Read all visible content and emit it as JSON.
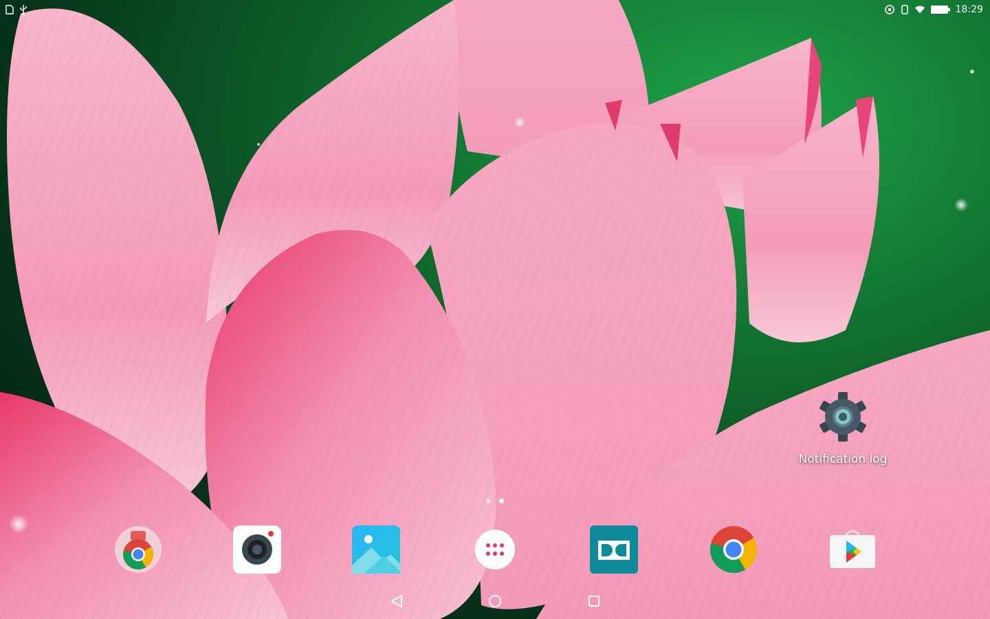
{
  "status_bar": {
    "time": "18:29",
    "left_icons": [
      "sd-card-icon",
      "usb-icon"
    ],
    "right_icons": [
      "data-saver-icon",
      "vibrate-icon",
      "wifi-icon",
      "battery-icon"
    ]
  },
  "shortcut": {
    "label": "Notification log",
    "icon": "settings-gear-icon"
  },
  "page_indicator": {
    "pages": 2,
    "active": 2
  },
  "dock": [
    {
      "name": "Chrome folder",
      "icon": "chrome-folder-icon"
    },
    {
      "name": "Camera",
      "icon": "camera-icon"
    },
    {
      "name": "Gallery",
      "icon": "gallery-icon"
    },
    {
      "name": "All apps",
      "icon": "app-drawer-icon"
    },
    {
      "name": "Dolby",
      "icon": "dolby-icon"
    },
    {
      "name": "Chrome",
      "icon": "chrome-icon"
    },
    {
      "name": "Play Store",
      "icon": "play-store-icon"
    }
  ],
  "nav_bar": [
    "back-icon",
    "home-icon",
    "recents-icon"
  ],
  "colors": {
    "wallpaper_green": "#0f6b2c",
    "petal_pink": "#f49ab8",
    "petal_deep": "#e0406e"
  }
}
